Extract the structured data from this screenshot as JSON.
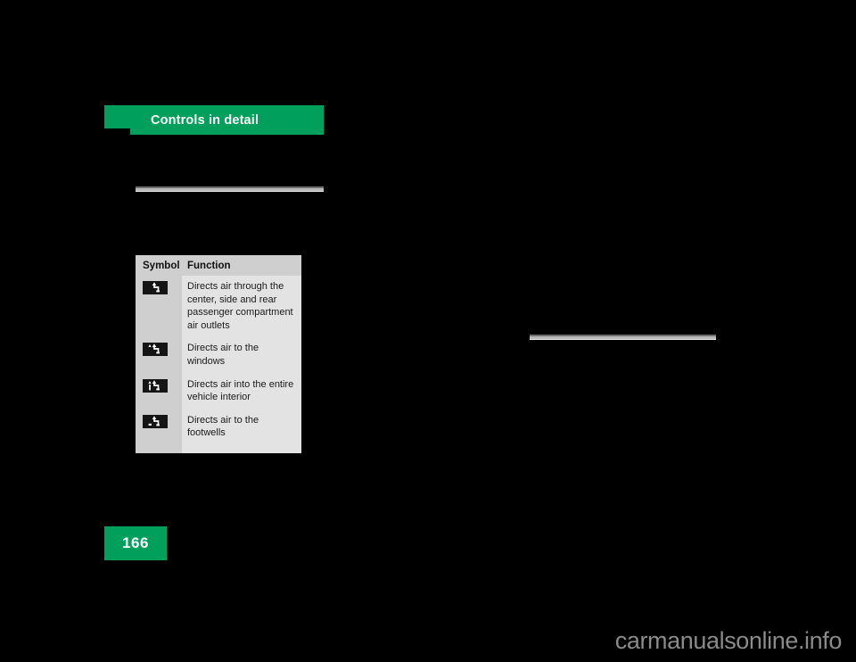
{
  "page": {
    "background_color": "#000000",
    "accent_green": "#00a05c",
    "page_number": "166"
  },
  "header": {
    "title": "Controls in detail"
  },
  "dividers": [
    {
      "name": "divider-left"
    },
    {
      "name": "divider-right"
    }
  ],
  "symbol_table": {
    "columns": {
      "symbol": "Symbol",
      "function": "Function"
    },
    "rows": [
      {
        "icon_name": "airflow-center-side-rear-icon",
        "function": "Directs air through the center, side and rear passenger compartment air outlets"
      },
      {
        "icon_name": "airflow-windows-icon",
        "function": "Directs air to the windows"
      },
      {
        "icon_name": "airflow-entire-interior-icon",
        "function": "Directs air into the entire vehicle interior"
      },
      {
        "icon_name": "airflow-footwells-icon",
        "function": "Directs air to the footwells"
      }
    ]
  },
  "watermark": {
    "text": "carmanualsonline.info"
  }
}
